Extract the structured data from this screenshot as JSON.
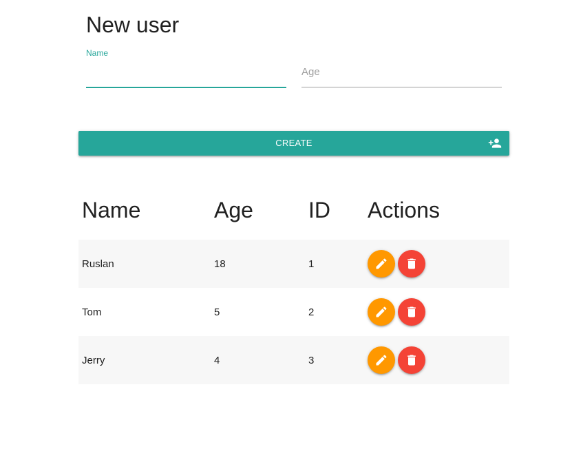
{
  "form": {
    "title": "New user",
    "name_label": "Name",
    "name_value": "",
    "age_placeholder": "Age",
    "age_value": "",
    "create_label": "CREATE",
    "create_icon": "person-add-icon"
  },
  "table": {
    "headers": [
      "Name",
      "Age",
      "ID",
      "Actions"
    ],
    "rows": [
      {
        "name": "Ruslan",
        "age": "18",
        "id": "1"
      },
      {
        "name": "Tom",
        "age": "5",
        "id": "2"
      },
      {
        "name": "Jerry",
        "age": "4",
        "id": "3"
      }
    ],
    "edit_icon": "pencil-icon",
    "delete_icon": "trash-icon"
  },
  "colors": {
    "primary": "#26a69a",
    "edit": "#ff9800",
    "delete": "#f44336"
  }
}
